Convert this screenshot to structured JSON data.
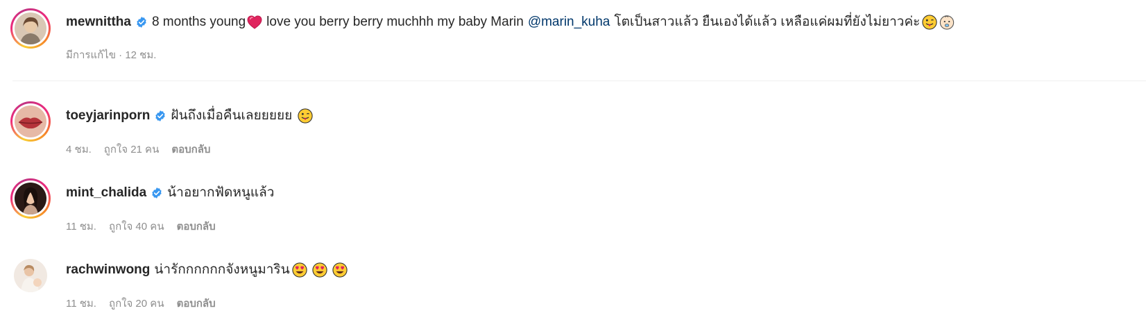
{
  "caption": {
    "username": "mewnittha",
    "text_before_heart": "8 months young",
    "text_after_heart": "love you berry berry muchhh my baby Marin",
    "mention": "@marin_kuha",
    "text_thai": "โตเป็นสาวแล้ว ยืนเองได้แล้ว เหลือแค่ผมที่ยังไม่ยาวค่ะ",
    "meta": "มีการแก้ไข · 12 ชม."
  },
  "comments": [
    {
      "username": "toeyjarinporn",
      "text": "ฝันถึงเมื่อคืนเลยยยยย",
      "time": "4 ชม.",
      "likes": "ถูกใจ 21 คน",
      "reply": "ตอบกลับ"
    },
    {
      "username": "mint_chalida",
      "text": "น้าอยากฟัดหนูแล้ว",
      "time": "11 ชม.",
      "likes": "ถูกใจ 40 คน",
      "reply": "ตอบกลับ"
    },
    {
      "username": "rachwinwong",
      "text": "น่ารักกกกกกจังหนูมาริน",
      "time": "11 ชม.",
      "likes": "ถูกใจ 20 คน",
      "reply": "ตอบกลับ"
    }
  ],
  "colors": {
    "text": "#262626",
    "muted": "#8e8e8e",
    "mention": "#00376b",
    "verified": "#3897f0"
  }
}
